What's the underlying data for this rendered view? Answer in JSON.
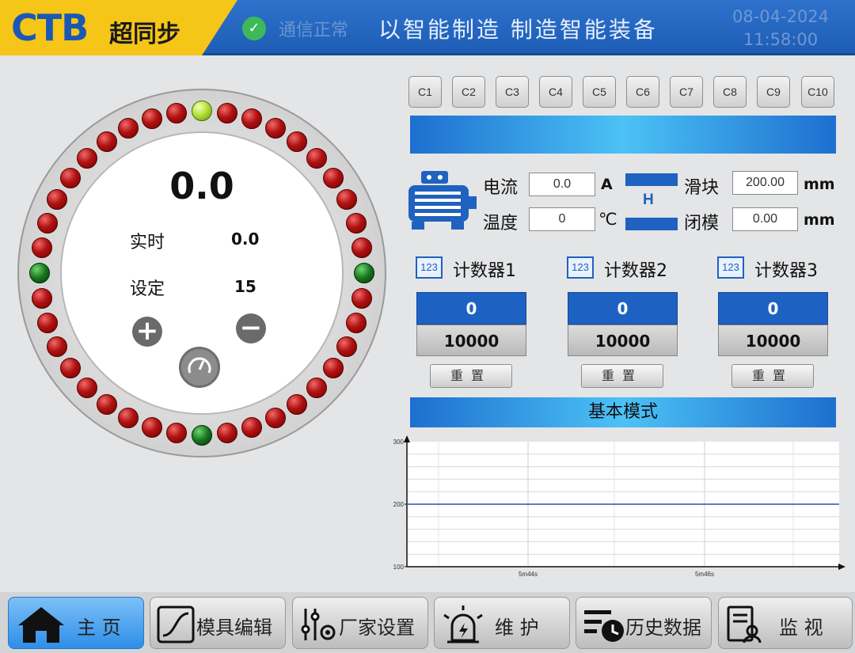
{
  "header": {
    "logo_text": "CTB",
    "logo_cn": "超同步",
    "comm_status": "通信正常",
    "slogan": "以智能制造  制造智能装备",
    "date": "08-04-2024",
    "time": "11:58:00",
    "icons": [
      "check-circle-icon"
    ]
  },
  "dial": {
    "value": "0.0",
    "realtime_label": "实时",
    "realtime_value": "0.0",
    "setpoint_label": "设定",
    "setpoint_value": "15",
    "led_count": 40,
    "active_leds": {
      "lime": [
        0
      ],
      "green": [
        10,
        20,
        30
      ]
    },
    "icons": [
      "plus-icon",
      "minus-icon",
      "gauge-icon"
    ]
  },
  "channels": [
    "C1",
    "C2",
    "C3",
    "C4",
    "C5",
    "C6",
    "C7",
    "C8",
    "C9",
    "C10"
  ],
  "motor": {
    "current_label": "电流",
    "current_value": "0.0",
    "current_unit": "A",
    "temp_label": "温度",
    "temp_value": "0",
    "temp_unit": "℃",
    "h_label": "H",
    "slider_label": "滑块",
    "slider_value": "200.00",
    "slider_unit": "mm",
    "close_label": "闭模",
    "close_value": "0.00",
    "close_unit": "mm",
    "icons": [
      "motor-icon"
    ]
  },
  "counters": [
    {
      "icon": "123",
      "title": "计数器1",
      "value": "0",
      "setpoint": "10000",
      "reset": "重置"
    },
    {
      "icon": "123",
      "title": "计数器2",
      "value": "0",
      "setpoint": "10000",
      "reset": "重置"
    },
    {
      "icon": "123",
      "title": "计数器3",
      "value": "0",
      "setpoint": "10000",
      "reset": "重置"
    }
  ],
  "mode_label": "基本模式",
  "chart_data": {
    "type": "line",
    "title": "",
    "xlabel": "",
    "ylabel": "",
    "ylim": [
      100,
      300
    ],
    "yticks": [
      "300",
      "200",
      "100"
    ],
    "xticks": [
      "5m44s",
      "5m46s"
    ],
    "series": [
      {
        "y": [
          200,
          200
        ]
      }
    ],
    "grid": true,
    "colors": {
      "line": "#2e4fb0",
      "grid": "#d8d8d8"
    }
  },
  "nav": [
    {
      "label": "主  页",
      "icon": "home-icon",
      "active": true
    },
    {
      "label": "模具编辑",
      "icon": "curve-icon",
      "active": false
    },
    {
      "label": "厂家设置",
      "icon": "settings-sliders-icon",
      "active": false
    },
    {
      "label": "维  护",
      "icon": "alarm-light-icon",
      "active": false
    },
    {
      "label": "历史数据",
      "icon": "history-icon",
      "active": false
    },
    {
      "label": "监    视",
      "icon": "monitor-report-icon",
      "active": false
    }
  ],
  "colors": {
    "accent": "#1f62bf",
    "logo_yellow": "#f5c518",
    "active_nav": "#2e8ee8"
  }
}
